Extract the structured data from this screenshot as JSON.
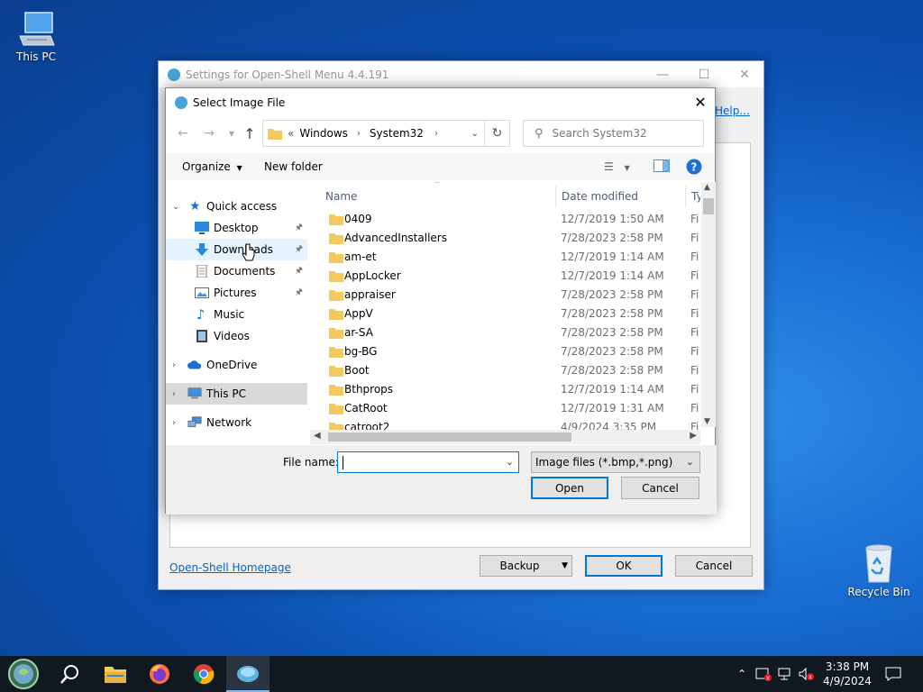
{
  "desktop": {
    "icons": [
      {
        "label": "This PC"
      },
      {
        "label": "Recycle Bin"
      }
    ]
  },
  "settings": {
    "title": "Settings for Open-Shell Menu 4.4.191",
    "help_link": "Help...",
    "homepage_link": "Open-Shell Homepage",
    "buttons": {
      "backup": "Backup",
      "ok": "OK",
      "cancel": "Cancel"
    }
  },
  "dialog": {
    "title": "Select Image File",
    "address": {
      "prefix": "«",
      "segments": [
        "Windows",
        "System32"
      ]
    },
    "search_placeholder": "Search System32",
    "toolbar": {
      "organize": "Organize",
      "new_folder": "New folder"
    },
    "nav": [
      {
        "label": "Quick access",
        "kind": "group"
      },
      {
        "label": "Desktop",
        "pinned": true
      },
      {
        "label": "Downloads",
        "pinned": true
      },
      {
        "label": "Documents",
        "pinned": true
      },
      {
        "label": "Pictures",
        "pinned": true
      },
      {
        "label": "Music",
        "pinned": false
      },
      {
        "label": "Videos",
        "pinned": false
      },
      {
        "label": "OneDrive",
        "kind": "group"
      },
      {
        "label": "This PC",
        "kind": "group",
        "selected": true
      },
      {
        "label": "Network",
        "kind": "group"
      }
    ],
    "columns": {
      "name": "Name",
      "date": "Date modified",
      "type": "Ty"
    },
    "files": [
      {
        "name": "0409",
        "date": "12/7/2019 1:50 AM",
        "type": "Fi"
      },
      {
        "name": "AdvancedInstallers",
        "date": "7/28/2023 2:58 PM",
        "type": "Fi"
      },
      {
        "name": "am-et",
        "date": "12/7/2019 1:14 AM",
        "type": "Fi"
      },
      {
        "name": "AppLocker",
        "date": "12/7/2019 1:14 AM",
        "type": "Fi"
      },
      {
        "name": "appraiser",
        "date": "7/28/2023 2:58 PM",
        "type": "Fi"
      },
      {
        "name": "AppV",
        "date": "7/28/2023 2:58 PM",
        "type": "Fi"
      },
      {
        "name": "ar-SA",
        "date": "7/28/2023 2:58 PM",
        "type": "Fi"
      },
      {
        "name": "bg-BG",
        "date": "7/28/2023 2:58 PM",
        "type": "Fi"
      },
      {
        "name": "Boot",
        "date": "7/28/2023 2:58 PM",
        "type": "Fi"
      },
      {
        "name": "Bthprops",
        "date": "12/7/2019 1:14 AM",
        "type": "Fi"
      },
      {
        "name": "CatRoot",
        "date": "12/7/2019 1:31 AM",
        "type": "Fi"
      },
      {
        "name": "catroot2",
        "date": "4/9/2024 3:35 PM",
        "type": "Fi"
      }
    ],
    "file_name_label": "File name:",
    "file_name_value": "",
    "filter": "Image files (*.bmp,*.png)",
    "buttons": {
      "open": "Open",
      "cancel": "Cancel"
    }
  },
  "taskbar": {
    "time": "3:38 PM",
    "date": "4/9/2024"
  },
  "colors": {
    "accent": "#0078d7",
    "link": "#0066cc",
    "folder": "#f4c95d"
  }
}
